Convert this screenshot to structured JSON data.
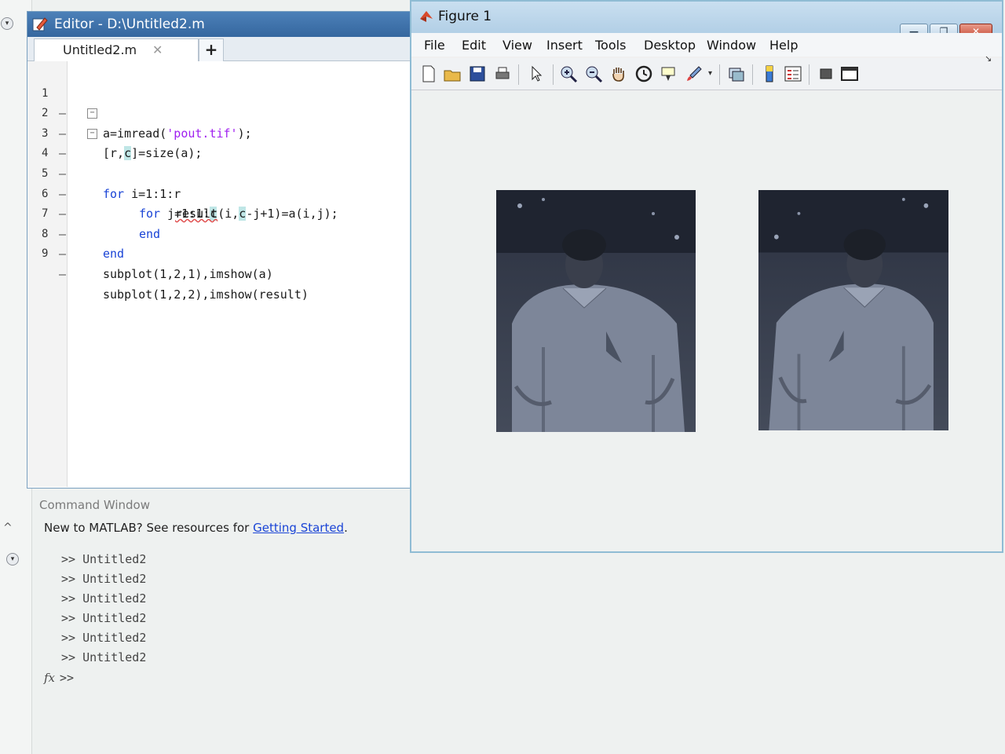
{
  "editor": {
    "title": "Editor - D:\\Untitled2.m",
    "tab_label": "Untitled2.m",
    "tab_close": "✕",
    "tab_add": "+"
  },
  "code_lines": [
    {
      "num": "1",
      "text": "a=imread('pout.tif');"
    },
    {
      "num": "2",
      "text": "[r,c]=size(a);"
    },
    {
      "num": "3",
      "text": "for i=1:1:r"
    },
    {
      "num": "4",
      "text": "for j=1:1:c"
    },
    {
      "num": "5",
      "text": "result(i,c-j+1)=a(i,j);"
    },
    {
      "num": "6",
      "text": "end"
    },
    {
      "num": "7",
      "text": "end"
    },
    {
      "num": "8",
      "text": "subplot(1,2,1),imshow(a)"
    },
    {
      "num": "9",
      "text": "subplot(1,2,2),imshow(result)"
    }
  ],
  "command_window": {
    "header": "Command Window",
    "banner_text": "New to MATLAB? See resources for ",
    "banner_link": "Getting Started",
    "banner_end": ".",
    "history": [
      ">> Untitled2",
      ">> Untitled2",
      ">> Untitled2",
      ">> Untitled2",
      ">> Untitled2",
      ">> Untitled2"
    ],
    "fx_symbol": "fx",
    "prompt": ">>"
  },
  "figure": {
    "title": "Figure 1",
    "menu": [
      "File",
      "Edit",
      "View",
      "Insert",
      "Tools",
      "Desktop",
      "Window",
      "Help"
    ],
    "window_buttons": [
      "—",
      "❐",
      "✕"
    ]
  },
  "colors": {
    "keyword": "#1a44d6",
    "string": "#a020f0",
    "editor_title_bar": "#35679f",
    "figure_title_bar": "#b2cfe6"
  }
}
